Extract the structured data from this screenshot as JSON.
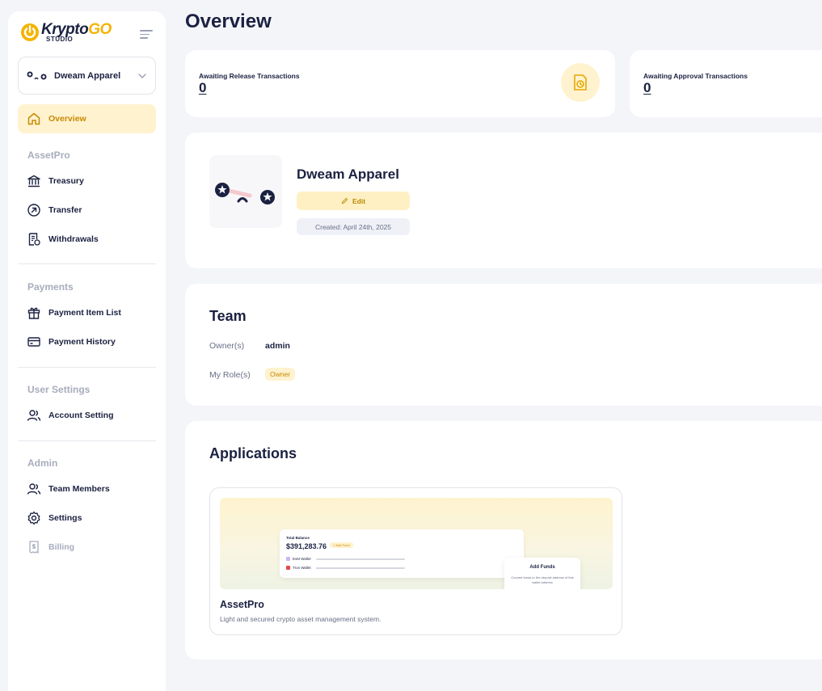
{
  "brand": {
    "name_part1": "Krypto",
    "name_part2": "GO",
    "sub": "STUDIO",
    "accent": "#f5b300"
  },
  "org_selector": {
    "name": "Dweam Apparel"
  },
  "sidebar": {
    "overview": "Overview",
    "sections": {
      "assetpro": "AssetPro",
      "payments": "Payments",
      "user_settings": "User Settings",
      "admin": "Admin"
    },
    "items": {
      "treasury": "Treasury",
      "transfer": "Transfer",
      "withdrawals": "Withdrawals",
      "payment_item_list": "Payment Item List",
      "payment_history": "Payment History",
      "account_setting": "Account Setting",
      "team_members": "Team Members",
      "settings": "Settings",
      "billing": "Billing"
    }
  },
  "header": {
    "title": "Overview"
  },
  "stats": [
    {
      "label": "Awaiting Release Transactions",
      "value": "0"
    },
    {
      "label": "Awaiting Approval Transactions",
      "value": "0"
    }
  ],
  "org": {
    "name": "Dweam Apparel",
    "edit_label": "Edit",
    "created": "Created: April 24th, 2025"
  },
  "team": {
    "title": "Team",
    "owner_label": "Owner(s)",
    "owner_value": "admin",
    "role_label": "My Role(s)",
    "role_value": "Owner"
  },
  "applications": {
    "title": "Applications",
    "items": [
      {
        "name": "AssetPro",
        "description": "Light and secured crypto asset management system.",
        "preview": {
          "balance_label": "Total Balance",
          "balance": "$391,283.76",
          "add_fund": "+ Add Fund",
          "wallet1": "EvM Wallet",
          "wallet2": "Tron Wallet",
          "popup_title": "Add Funds",
          "popup_text": "Convert funds to the deposit address of this wallet address"
        }
      }
    ]
  }
}
